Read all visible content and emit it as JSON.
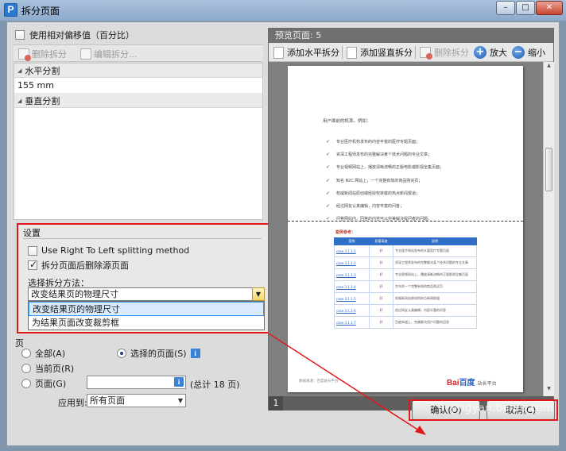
{
  "window": {
    "title": "拆分页面",
    "app_icon": "P",
    "minimize": "–",
    "maximize": "□",
    "close": "✕"
  },
  "left": {
    "use_relative_offset": "使用相对偏移值（百分比）",
    "toolbar": {
      "delete_split": "删除拆分",
      "edit_split": "编辑拆分..."
    },
    "tree": {
      "horizontal_section": "水平分割",
      "horizontal_value": "155 mm",
      "vertical_section": "垂直分割"
    }
  },
  "settings": {
    "header": "设置",
    "rtl_option": "Use Right To Left splitting method",
    "remove_source_option": "拆分页面后删除源页面",
    "method_label": "选择拆分方法：",
    "method_selected": "改变结果页的物理尺寸",
    "method_options": [
      "改变结果页的物理尺寸",
      "为结果页面改变裁剪框"
    ]
  },
  "range": {
    "section_label": "页",
    "all_pages": "全部(A)",
    "selected_pages": "选择的页面(S)",
    "current_page": "当前页(R)",
    "pages": "页面(G)",
    "total_text": "(总计 18 页)",
    "apply_to_label": "应用到:",
    "apply_to_value": "所有页面",
    "info_glyph": "i"
  },
  "preview": {
    "title": "预览页面: 5",
    "add_horizontal": "添加水平拆分",
    "add_vertical": "添加竖直拆分",
    "delete_split": "删除拆分",
    "zoom_in": "放大",
    "zoom_out": "缩小",
    "page_number": "1",
    "doc": {
      "intro": "用户面前的机率。例如：",
      "bullets": [
        "专业医疗机构发布的内容丰富的医疗专题页面；",
        "资深工程师发布的完整解决某个技术问题的专业文章；",
        "专业视频网站上，播放清晰流畅的正版电影或影视全集页面；",
        "知名 B2C 网站上，一个完整有效的商品购买页；",
        "权威新闻站原创或经授权转载的热点新闻报道；",
        "经过网友认真编辑，内容丰富的问答；",
        "问答网站内，回答的内容可以完美解决提问者的问题。"
      ],
      "case_heading": "案例参考：",
      "table_headers": [
        "案例",
        "质量高度",
        "说明"
      ],
      "table_rows": [
        [
          "case 3.1.1-1",
          "好",
          "专业医疗网站发布的丰富医疗专题页面"
        ],
        [
          "case 3.1.1-2",
          "好",
          "资深工程师发布的完整解决某个技术问题的专业文章"
        ],
        [
          "case 3.1.1-3",
          "好",
          "专业视频网站上，播放清晰流畅的正版影视全集页面"
        ],
        [
          "case 3.1.1-4",
          "好",
          "京东的一个完整有效的商品购买页"
        ],
        [
          "case 3.1.1-5",
          "好",
          "权威新闻站原创的热点新闻报道"
        ],
        [
          "case 3.1.1-6",
          "好",
          "经过网友认真编辑，内容丰富的问答"
        ],
        [
          "case 3.1.1-7",
          "好",
          "百度知道上，完美解决用户问题的回答"
        ]
      ],
      "footer": "数据来源：百度站长平台",
      "logo_bai": "Bai",
      "logo_du": "百度",
      "logo_suffix": "站长平台"
    }
  },
  "buttons": {
    "ok": "确认(O)",
    "cancel": "取消(C)"
  },
  "watermark": "jingyan.baidu.com",
  "colors": {
    "highlight": "#e11818",
    "accent": "#2f6fc8"
  }
}
